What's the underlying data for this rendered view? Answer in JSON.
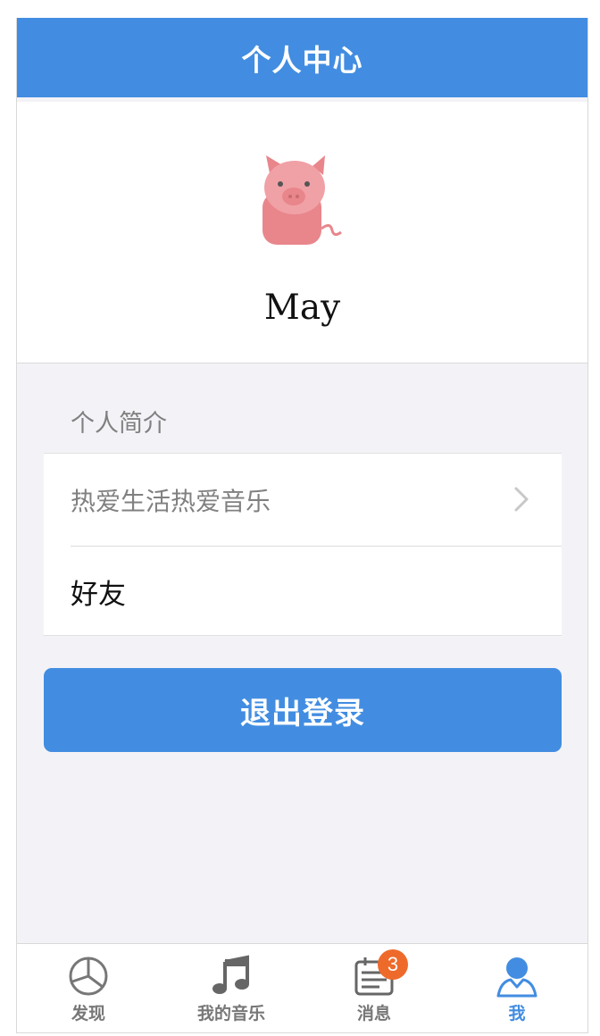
{
  "navbar": {
    "title": "个人中心"
  },
  "profile": {
    "avatar_icon": "pig-avatar-icon",
    "username": "May"
  },
  "bio": {
    "section_label": "个人简介",
    "text": "热爱生活热爱音乐"
  },
  "friends": {
    "label": "好友",
    "icon": "chevron-right-icon"
  },
  "logout": {
    "label": "退出登录"
  },
  "tabbar": {
    "tabs": [
      {
        "label": "发现",
        "icon": "pie-chart-icon",
        "active": false
      },
      {
        "label": "我的音乐",
        "icon": "music-note-icon",
        "active": false
      },
      {
        "label": "消息",
        "icon": "calendar-icon",
        "active": false,
        "badge": "3"
      },
      {
        "label": "我",
        "icon": "user-icon",
        "active": true
      }
    ]
  },
  "colors": {
    "primary": "#428de1",
    "badge": "#ee6a2b",
    "background": "#f3f3f7",
    "inactive_tab": "#777777"
  }
}
